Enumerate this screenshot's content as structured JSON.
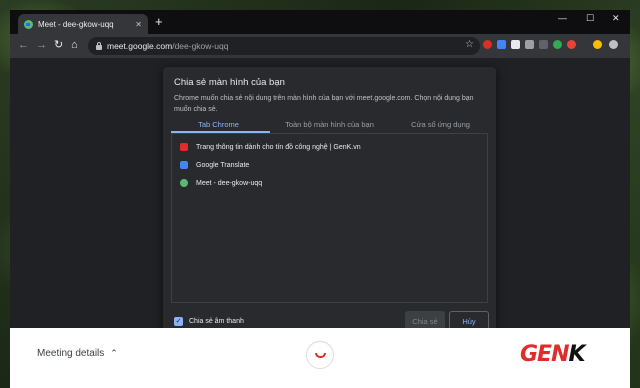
{
  "browser": {
    "tab_title": "Meet - dee-gkow-uqq",
    "tab_close": "✕",
    "new_tab": "+",
    "window_controls": [
      "—",
      "☐",
      "✕"
    ],
    "url_host": "meet.google.com",
    "url_path": "/dee-gkow-uqq",
    "nav_icons": [
      "back-icon",
      "forward-icon",
      "reload-icon",
      "home-icon"
    ]
  },
  "dialog": {
    "title": "Chia sẻ màn hình của bạn",
    "description": "Chrome muốn chia sẻ nội dung trên màn hình của bạn với meet.google.com. Chọn nội dung bạn muốn chia sẻ.",
    "tabs": [
      {
        "label": "Tab Chrome",
        "active": true
      },
      {
        "label": "Toàn bộ màn hình của bạn",
        "active": false
      },
      {
        "label": "Cửa sổ ứng dụng",
        "active": false
      }
    ],
    "items": [
      {
        "label": "Trang thông tin dành cho tín đồ công nghệ | GenK.vn",
        "icon": "genk-favicon-icon"
      },
      {
        "label": "Google Translate",
        "icon": "google-translate-icon"
      },
      {
        "label": "Meet - dee-gkow-uqq",
        "icon": "meet-icon"
      }
    ],
    "share_audio_label": "Chia sẻ âm thanh",
    "share_audio_checked": true,
    "share_button": "Chia sẻ",
    "cancel_button": "Hủy"
  },
  "meet": {
    "meeting_details": "Meeting details",
    "chevron": "⌃"
  },
  "watermark": {
    "brand_red": "GEN",
    "brand_black": "K"
  },
  "colors": {
    "accent": "#8ab4f8",
    "dialog_bg": "#292a2d",
    "hangup": "#d93025",
    "brand": "#e22b2b"
  }
}
